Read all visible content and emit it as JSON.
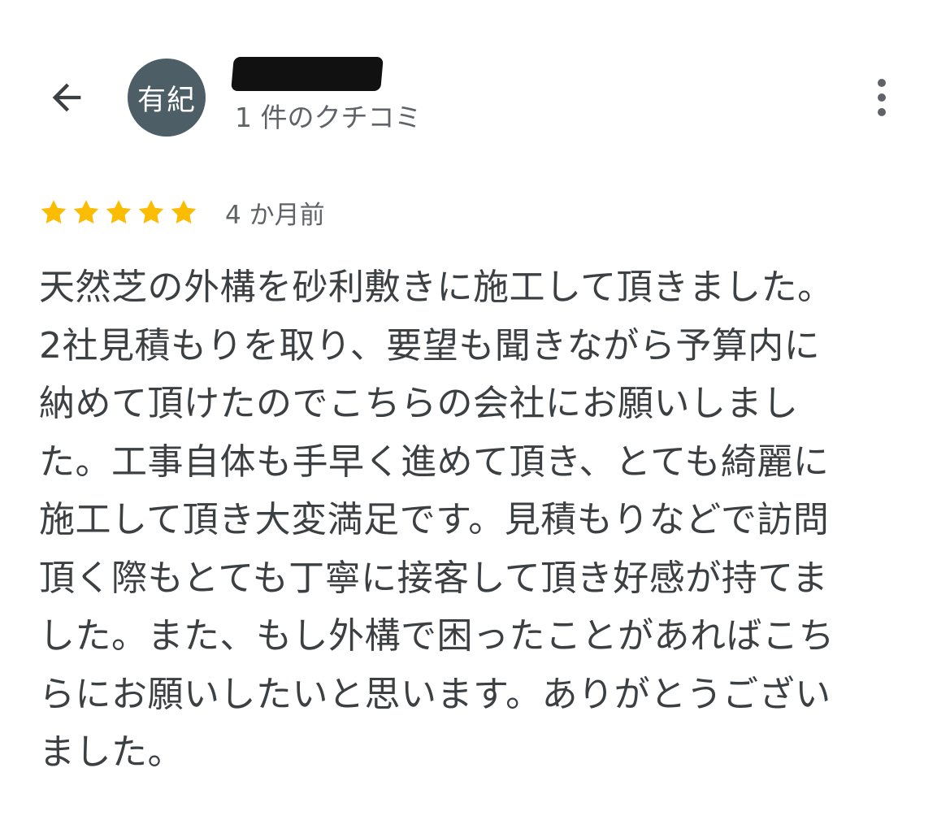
{
  "header": {
    "back_icon": "arrow-left-icon",
    "avatar_text": "有紀",
    "reviewer_name": "redacted",
    "review_count": "1 件のクチコミ",
    "more_icon": "more-vertical-icon"
  },
  "review": {
    "rating": 5,
    "rating_max": 5,
    "star_color": "#fbbc04",
    "date": "4 か月前",
    "lines": [
      "天然芝の外構を砂利敷きに施工して頂きました。",
      "2社見積もりを取り、要望も聞きながら予算内に",
      "納めて頂けたのでこちらの会社にお願いしまし",
      "た。工事自体も手早く進めて頂き、とても綺麗に",
      "施工して頂き大変満足です。見積もりなどで訪問",
      "頂く際もとても丁寧に接客して頂き好感が持てま",
      "した。また、もし外構で困ったことがあればこち",
      "らにお願いしたいと思います。ありがとうござい",
      "ました。"
    ]
  },
  "colors": {
    "avatar_background": "#4e5e66",
    "secondary_text": "#5f6368",
    "primary_text": "#3c4043"
  }
}
